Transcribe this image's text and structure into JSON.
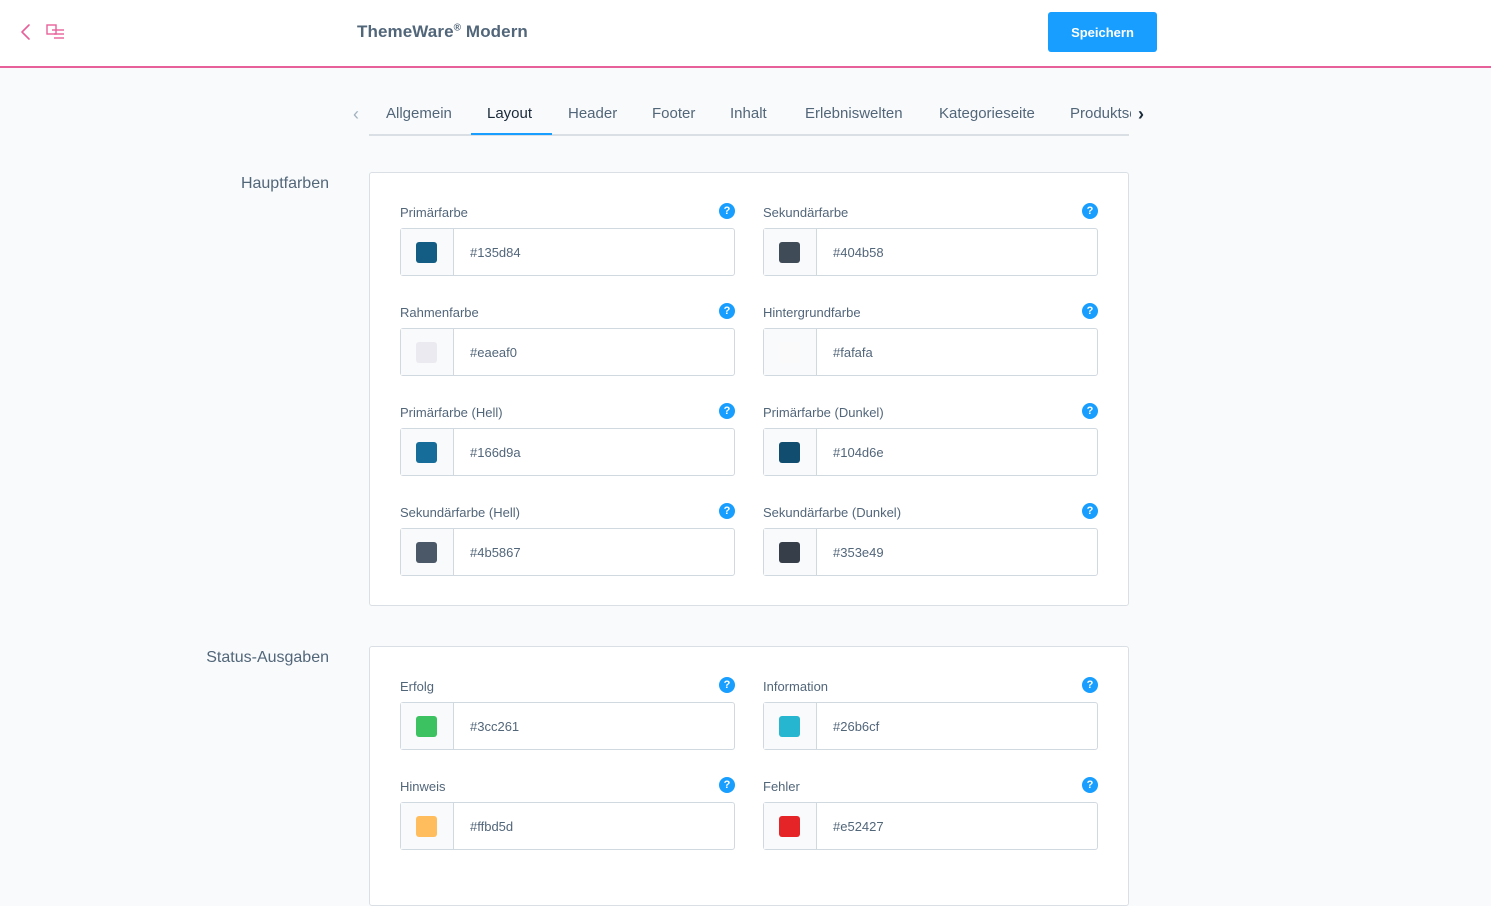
{
  "header": {
    "title": "ThemeWare",
    "title_sup": "®",
    "title_suffix": " Modern",
    "save_label": "Speichern"
  },
  "tabs": [
    {
      "label": "Allgemein"
    },
    {
      "label": "Layout"
    },
    {
      "label": "Header"
    },
    {
      "label": "Footer"
    },
    {
      "label": "Inhalt"
    },
    {
      "label": "Erlebniswelten"
    },
    {
      "label": "Kategorieseite"
    },
    {
      "label": "Produktseite"
    }
  ],
  "active_tab": "Layout",
  "sections": {
    "main_colors": {
      "label": "Hauptfarben",
      "fields": [
        {
          "label": "Primärfarbe",
          "value": "#135d84",
          "color": "#135d84"
        },
        {
          "label": "Sekundärfarbe",
          "value": "#404b58",
          "color": "#404b58"
        },
        {
          "label": "Rahmenfarbe",
          "value": "#eaeaf0",
          "color": "#eaeaf0"
        },
        {
          "label": "Hintergrundfarbe",
          "value": "#fafafa",
          "color": "#fafafa"
        },
        {
          "label": "Primärfarbe (Hell)",
          "value": "#166d9a",
          "color": "#166d9a"
        },
        {
          "label": "Primärfarbe (Dunkel)",
          "value": "#104d6e",
          "color": "#104d6e"
        },
        {
          "label": "Sekundärfarbe (Hell)",
          "value": "#4b5867",
          "color": "#4b5867"
        },
        {
          "label": "Sekundärfarbe (Dunkel)",
          "value": "#353e49",
          "color": "#353e49"
        }
      ]
    },
    "status": {
      "label": "Status-Ausgaben",
      "fields": [
        {
          "label": "Erfolg",
          "value": "#3cc261",
          "color": "#3cc261"
        },
        {
          "label": "Information",
          "value": "#26b6cf",
          "color": "#26b6cf"
        },
        {
          "label": "Hinweis",
          "value": "#ffbd5d",
          "color": "#ffbd5d"
        },
        {
          "label": "Fehler",
          "value": "#e52427",
          "color": "#e52427"
        }
      ]
    }
  },
  "help_icon_glyph": "?",
  "colors": {
    "accent": "#189eff",
    "header_border": "#e7609a",
    "back_icon": "#e7609a"
  }
}
